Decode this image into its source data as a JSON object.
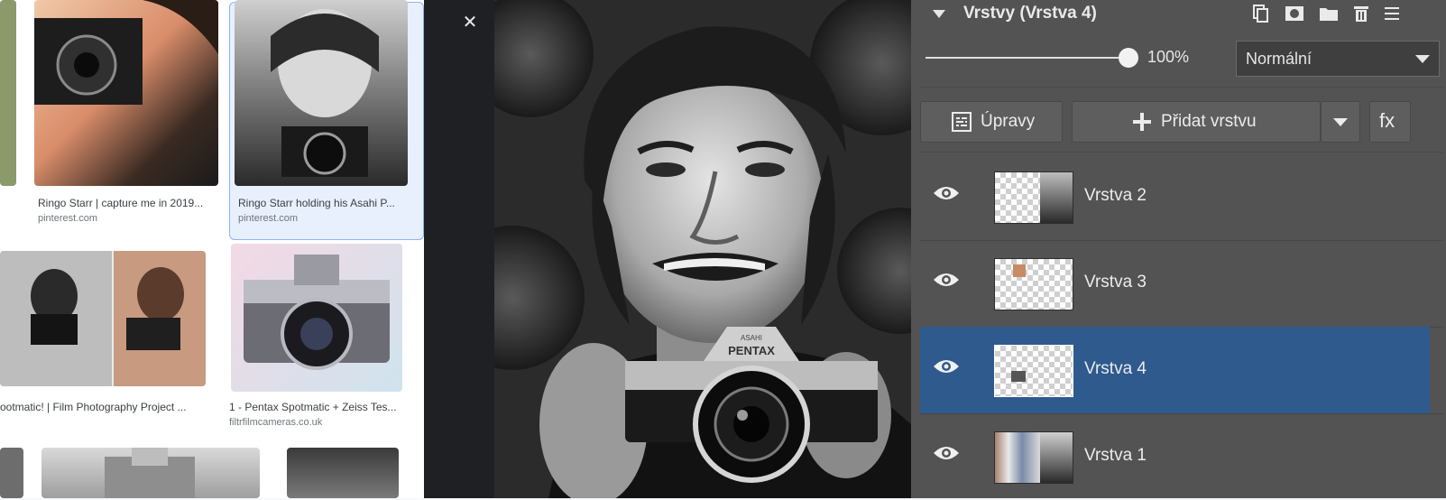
{
  "results": {
    "cards": [
      {
        "caption": "Ringo Starr | capture me in 2019...",
        "source": "pinterest.com"
      },
      {
        "caption": "Ringo Starr holding his Asahi P...",
        "source": "pinterest.com"
      },
      {
        "caption": "ootmatic! | Film Photography Project ...",
        "source": ""
      },
      {
        "caption": "1 - Pentax Spotmatic + Zeiss Tes...",
        "source": "filtrfilmcameras.co.uk"
      }
    ]
  },
  "preview": {
    "close_icon": "close-icon",
    "collapse_icon": "chevron-left-icon",
    "camera_brand": "PENTAX",
    "camera_maker": "ASAHI"
  },
  "layers_panel": {
    "title": "Vrstvy (Vrstva 4)",
    "opacity": "100%",
    "opacity_value": 1.0,
    "blend_mode": "Normální",
    "adjust_label": "Úpravy",
    "add_layer_label": "Přidat vrstvu",
    "fx_label": "fx",
    "layers": [
      {
        "name": "Vrstva 2",
        "selected": false
      },
      {
        "name": "Vrstva 3",
        "selected": false
      },
      {
        "name": "Vrstva 4",
        "selected": true
      },
      {
        "name": "Vrstva 1",
        "selected": false
      }
    ]
  },
  "colors": {
    "panel_bg": "#535353",
    "selected_layer": "#2e5a8e",
    "preview_bg": "#202124"
  }
}
